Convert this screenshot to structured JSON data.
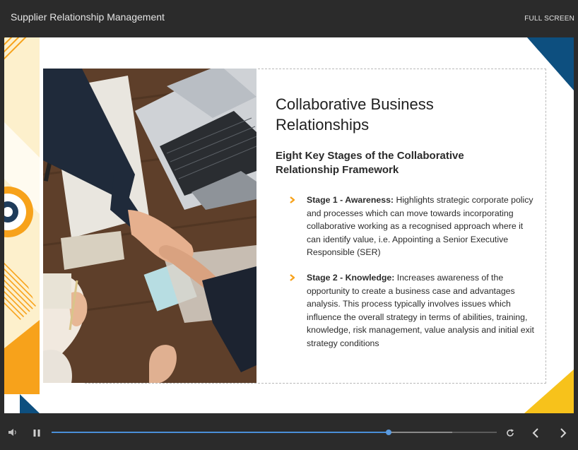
{
  "player": {
    "title": "Supplier Relationship Management",
    "fullscreen_label": "FULL SCREEN"
  },
  "slide": {
    "heading": "Collaborative Business Relationships",
    "subheading": "Eight Key Stages of the Collaborative Relationship Framework",
    "stages": [
      {
        "title": "Stage 1 - Awareness:",
        "text": " Highlights strategic corporate policy and processes which can move towards incorporating collaborative working as a recognised approach where it can identify value, i.e. Appointing a Senior Executive Responsible (SER)"
      },
      {
        "title": "Stage 2 - Knowledge:",
        "text": " Increases awareness of the opportunity to create a business case and advantages analysis. This process typically involves issues which influence the overall strategy in terms of abilities, training, knowledge, risk management, value analysis and initial exit strategy conditions"
      }
    ],
    "image": "handshake-over-desk-photo"
  },
  "colors": {
    "accent_orange": "#f7a21b",
    "accent_yellow": "#f7c21b",
    "accent_navy": "#0d4f7f",
    "pale_yellow": "#fdf0cc",
    "chevron": "#f7a21b",
    "progress": "#4a8fd8"
  },
  "controls": {
    "progress_fraction": 0.757,
    "buffer_fraction": 0.9,
    "icons": [
      "volume-icon",
      "pause-icon",
      "replay-icon",
      "previous-icon",
      "next-icon"
    ]
  }
}
